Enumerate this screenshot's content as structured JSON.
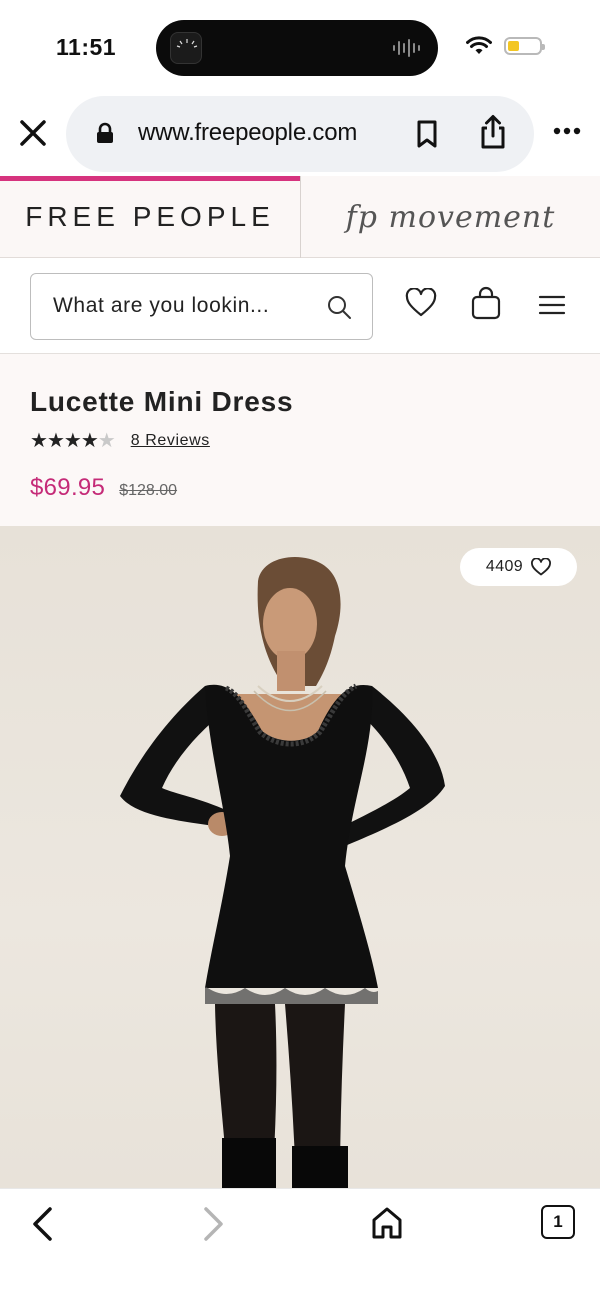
{
  "status_bar": {
    "time": "11:51"
  },
  "browser": {
    "url": "www.freepeople.com"
  },
  "brand": {
    "primary": "FREE PEOPLE",
    "secondary": "fp movement",
    "accent_color": "#d6337e"
  },
  "search": {
    "placeholder": "What are you lookin..."
  },
  "product": {
    "title": "Lucette Mini Dress",
    "rating": 4,
    "rating_max": 5,
    "reviews_label": "8 Reviews",
    "sale_price": "$69.95",
    "original_price": "$128.00",
    "favorites_count": "4409"
  },
  "toolbar": {
    "tabs_count": "1"
  }
}
